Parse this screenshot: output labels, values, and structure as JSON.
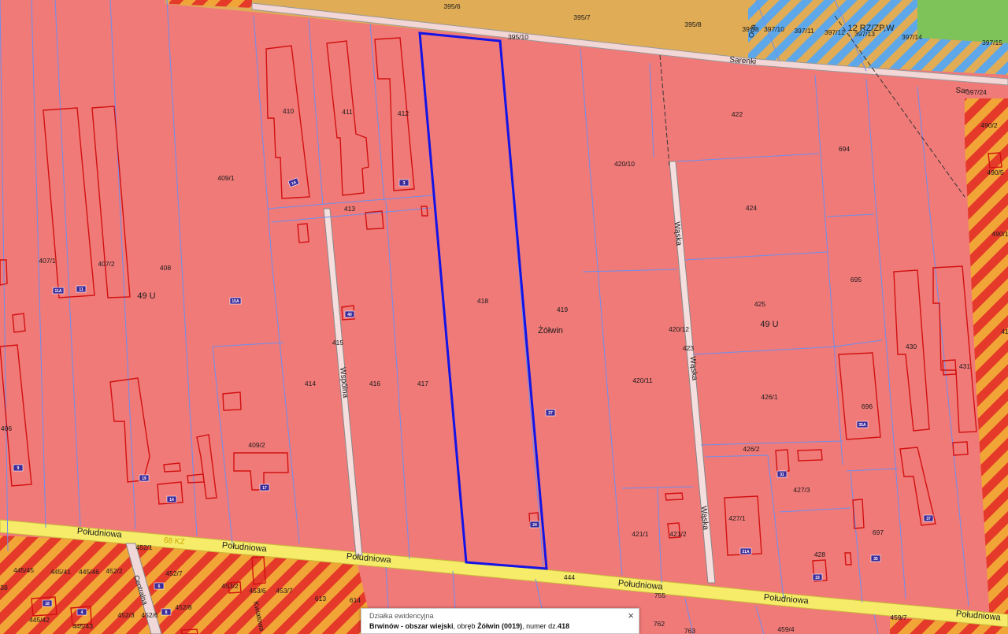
{
  "colors": {
    "zone_u": "#f07a78",
    "zone_top": "#e0ac55",
    "zone_green": "#7ec35a",
    "zone_blue_stripe": "#5ea8ea",
    "stripe_red": "#e53a2a",
    "stripe_orange": "#f2a537",
    "road_yellow": "#f6ec6a",
    "parcel_line": "#6b8ff0",
    "building": "#d11111",
    "selected": "#1414e6",
    "label_box": "#3d2b9a"
  },
  "parcels": {
    "p395_6": "395/6",
    "p395_7": "395/7",
    "p395_8": "395/8",
    "p395_10": "395/10",
    "p397_8": "397/8",
    "p397_10": "397/10",
    "p397_11": "397/11",
    "p397_12": "397/12",
    "p397_13": "397/13",
    "p397_14": "397/14",
    "p397_15": "397/15",
    "p397_24": "397/24",
    "p407_1": "407/1",
    "p407_2": "407/2",
    "p408": "408",
    "p409_1": "409/1",
    "p409_2": "409/2",
    "p410": "410",
    "p411": "411",
    "p412": "412",
    "p413": "413",
    "p414": "414",
    "p415": "415",
    "p416": "416",
    "p417": "417",
    "p418": "418",
    "p419": "419",
    "p420_10": "420/10",
    "p420_11": "420/11",
    "p420_12": "420/12",
    "p421_1": "421/1",
    "p421_2": "421/2",
    "p422": "422",
    "p423": "423",
    "p424": "424",
    "p425": "425",
    "p426_1": "426/1",
    "p426_2": "426/2",
    "p427_1": "427/1",
    "p427_3": "427/3",
    "p428": "428",
    "p430": "430",
    "p431": "431",
    "p444": "444",
    "p445_41": "445/41",
    "p445_42": "445/42",
    "p445_43": "445/43",
    "p445_45": "445/45",
    "p445_46": "445/46",
    "p452_1": "452/1",
    "p452_2": "452/2",
    "p452_3": "452/3",
    "p452_6": "452/6",
    "p452_7": "452/7",
    "p452_8": "452/8",
    "p453_2": "453/2",
    "p453_6": "453/6",
    "p453_7": "453/7",
    "p459_4": "459/4",
    "p459_7": "459/7",
    "p490_2": "490/2",
    "p490_5": "490/5",
    "p490_1": "490/1",
    "p406": "406",
    "p613": "613",
    "p614": "614",
    "p694": "694",
    "p695": "695",
    "p696": "696",
    "p697": "697",
    "p755": "755",
    "p762": "762",
    "p763": "763",
    "p38": "38",
    "p41": "41"
  },
  "zones": {
    "z49u_left": "49 U",
    "z49u_right": "49 U",
    "z12rz": "12 RZ/ZP,W",
    "z68kz": "68 KZ"
  },
  "streets": {
    "poludniowa": "Południowa",
    "waska": "Wąska",
    "waska_short": "Wąska",
    "wspolna": "Wspólna",
    "sarenki": "Sarenki",
    "sarenki_short": "Sar",
    "orla": "Orla",
    "centralna": "Centralna",
    "kwiatowa": "Kwiatowa",
    "village": "Żółwin"
  },
  "house_numbers": {
    "n1a": "1A",
    "n3": "3",
    "n11a": "11A",
    "n11": "11",
    "n15a": "15A",
    "n40": "40",
    "n9": "9",
    "n19": "19",
    "n14": "14",
    "n17": "17",
    "n27": "27",
    "n24": "24",
    "n35a": "35A",
    "n31": "31",
    "n37": "37",
    "n31a": "31A",
    "n33": "33",
    "n35": "35",
    "n18": "18",
    "n4": "4",
    "n6": "6",
    "n8": "8"
  },
  "popup": {
    "title": "Działka ewidencyjna",
    "municipality": "Brwinów - obszar wiejski",
    "precinct_text": ", obręb ",
    "precinct": "Żółwin (0019)",
    "number_text": ", numer dz.",
    "number": "418",
    "close_icon": "×"
  }
}
